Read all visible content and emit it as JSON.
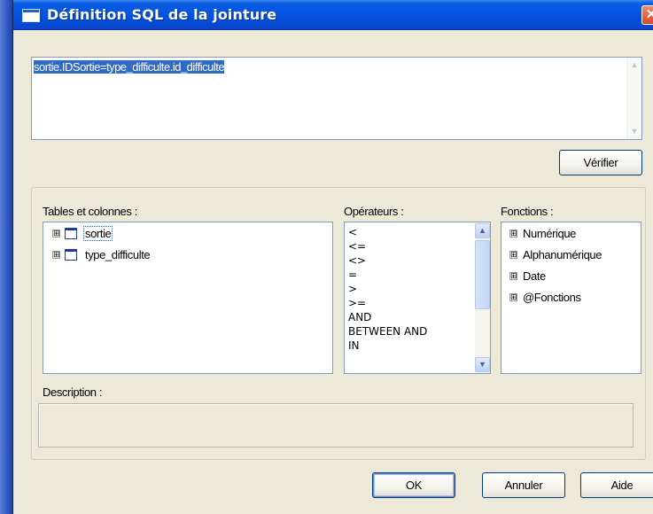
{
  "window": {
    "title": "Définition SQL de la jointure",
    "close_glyph": "✕"
  },
  "sql": {
    "text": "sortie.IDSortie=type_difficulte.id_difficulte"
  },
  "buttons": {
    "verifier": "Vérifier",
    "ok": "OK",
    "annuler": "Annuler",
    "aide": "Aide"
  },
  "tables": {
    "label": "Tables et colonnes :",
    "items": [
      {
        "name": "sortie"
      },
      {
        "name": "type_difficulte"
      }
    ]
  },
  "operators": {
    "label": "Opérateurs :",
    "items": [
      "<",
      "<=",
      "<>",
      "=",
      ">",
      ">=",
      "AND",
      "BETWEEN AND",
      "IN"
    ]
  },
  "functions": {
    "label": "Fonctions :",
    "items": [
      "Numérique",
      "Alphanumérique",
      "Date",
      "@Fonctions"
    ]
  },
  "description": {
    "label": "Description :",
    "value": ""
  },
  "icons": {
    "expand": "⊞",
    "scroll_up": "▲",
    "scroll_down": "▼"
  },
  "colors": {
    "titlebar": "#0553e0",
    "selection": "#316ac5",
    "window_bg": "#ece9d8"
  }
}
